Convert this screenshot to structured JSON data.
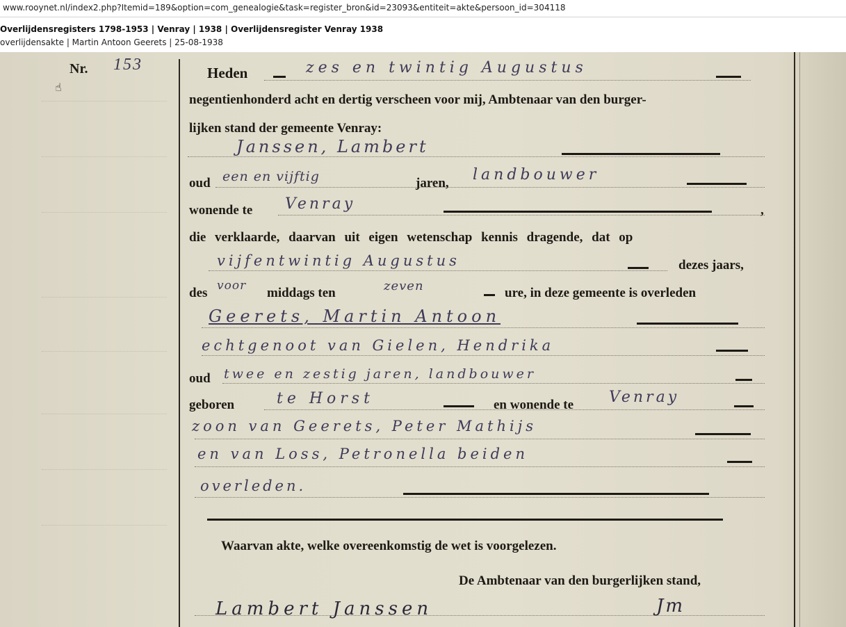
{
  "browser": {
    "url": "www.rooynet.nl/index2.php?Itemid=189&option=com_genealogie&task=register_bron&id=23093&entiteit=akte&persoon_id=304118"
  },
  "header": {
    "title": "Overlijdensregisters 1798-1953 | Venray | 1938 | Overlijdensregister Venray 1938",
    "subtitle": "overlijdensakte | Martin Antoon Geerets | 25-08-1938"
  },
  "document": {
    "nr_label": "Nr.",
    "nr_value": "153",
    "printed": {
      "heden": "Heden",
      "line2": "negentienhonderd acht en dertig verscheen voor mij, Ambtenaar van den burger-",
      "line3": "lijken stand der gemeente Venray:",
      "oud1": "oud",
      "jaren1": "jaren,",
      "wonende_te": "wonende te",
      "comma": ",",
      "verklaarde": "die verklaarde, daarvan uit eigen wetenschap kennis dragende, dat op",
      "dezes_jaars": "dezes jaars,",
      "des": "des",
      "middags_ten": "middags ten",
      "ure": "ure, in deze gemeente is overleden",
      "oud2": "oud",
      "geboren": "geboren",
      "en_wonende_te": "en wonende te",
      "waarvan": "Waarvan akte, welke overeenkomstig de wet is voorgelezen.",
      "ambtenaar": "De Ambtenaar van den burgerlijken stand,"
    },
    "handwritten": {
      "date": "zes en twintig Augustus",
      "declarant": "Janssen, Lambert",
      "age1": "een en vijftig",
      "occupation1": "landbouwer",
      "residence1": "Venray",
      "date_death": "vijfentwintig Augustus",
      "daypart": "voor",
      "hour": "zeven",
      "deceased": "Geerets, Martin Antoon",
      "spouse": "echtgenoot van Gielen, Hendrika",
      "age2": "twee en zestig jaren, landbouwer",
      "birthplace": "te Horst",
      "residence2": "Venray",
      "father": "zoon van Geerets, Peter Mathijs",
      "mother": "en van Loss, Petronella beiden",
      "status": "overleden.",
      "signature_declarant": "Lambert Janssen",
      "signature_official": "Jm"
    }
  },
  "colors": {
    "paper": "#e0dccb",
    "ink_print": "#1d1a15",
    "ink_hand": "#3e3a58"
  }
}
